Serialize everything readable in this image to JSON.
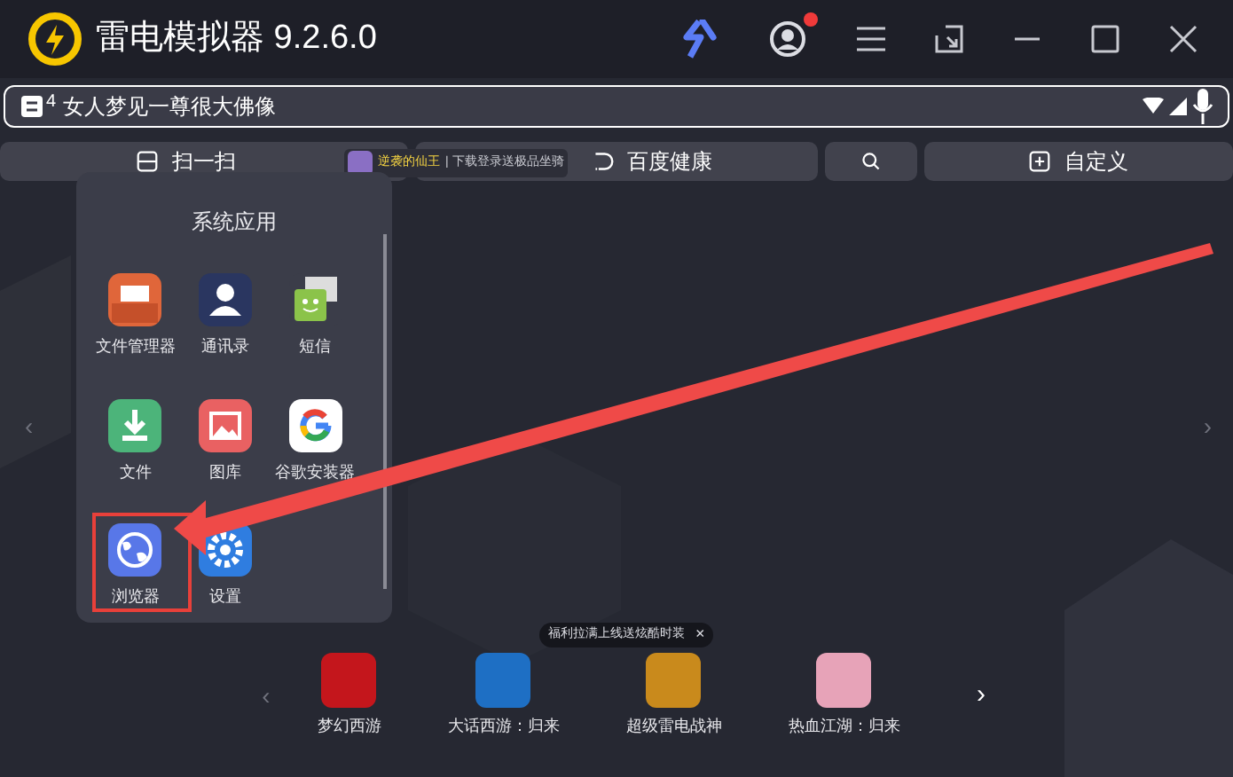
{
  "window": {
    "title": "雷电模拟器 9.2.6.0",
    "notification_dot": true
  },
  "ticker": {
    "status": "4",
    "text": "女人梦见一尊很大佛像"
  },
  "quick_bar": [
    {
      "kind": "scan",
      "label": "扫一扫"
    },
    {
      "kind": "health",
      "label": "百度健康"
    },
    {
      "kind": "search"
    },
    {
      "kind": "custom",
      "label": "自定义"
    }
  ],
  "ad": {
    "title": "逆袭的仙王",
    "text": "| 下载登录送极品坐骑"
  },
  "folder": {
    "title": "系统应用",
    "apps": [
      {
        "kind": "files-manager",
        "label": "文件管理器",
        "highlighted": false
      },
      {
        "kind": "contacts",
        "label": "通讯录",
        "highlighted": false
      },
      {
        "kind": "sms",
        "label": "短信",
        "highlighted": false
      },
      {
        "kind": "download",
        "label": "文件",
        "highlighted": false
      },
      {
        "kind": "gallery",
        "label": "图库",
        "highlighted": false
      },
      {
        "kind": "google",
        "label": "谷歌安装器",
        "highlighted": false
      },
      {
        "kind": "browser",
        "label": "浏览器",
        "highlighted": true
      },
      {
        "kind": "settings",
        "label": "设置",
        "highlighted": false
      }
    ]
  },
  "nav": {
    "prev": "‹",
    "next": "›"
  },
  "promo_tip": {
    "text": "福利拉满上线送炫酷时装",
    "close": "×"
  },
  "games": {
    "prev": "‹",
    "next": "›",
    "items": [
      {
        "label": "梦幻西游",
        "color": "#c4161c"
      },
      {
        "label": "大话西游：归来",
        "color": "#1e6fc4"
      },
      {
        "label": "超级雷电战神",
        "color": "#c98a1c"
      },
      {
        "label": "热血江湖：归来",
        "color": "#e7a3b8"
      }
    ]
  }
}
